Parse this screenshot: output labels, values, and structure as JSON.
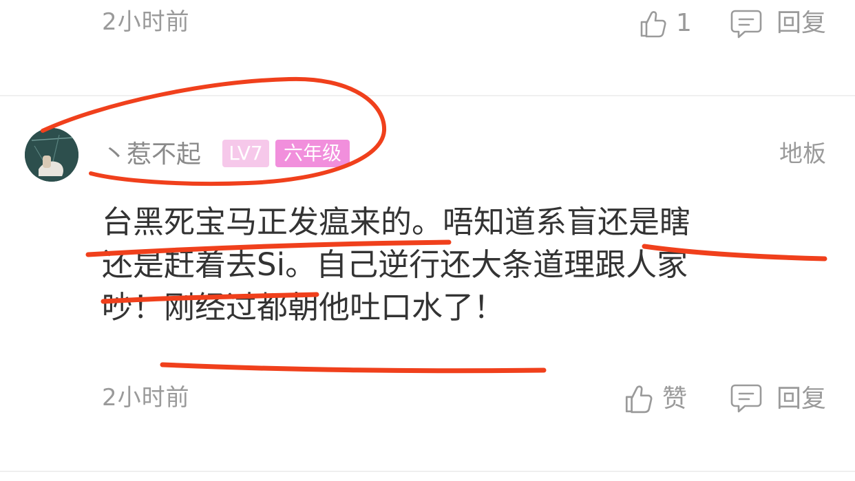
{
  "previous_comment": {
    "timestamp": "2小时前",
    "like_count": "1",
    "reply_label": "回复",
    "like_icon": "thumbs-up-icon",
    "reply_icon": "comment-bubble-icon"
  },
  "comment": {
    "username": "丶惹不起",
    "level_badge": "LV7",
    "grade_badge": "六年级",
    "floor_label": "地板",
    "content_lines": [
      "台黑死宝马正发瘟来的。唔知道系盲还是瞎",
      "还是赶着去Si。自己逆行还大条道理跟人家",
      "吵！刚经过都朝他吐口水了！"
    ],
    "timestamp": "2小时前",
    "like_label": "赞",
    "reply_label": "回复",
    "like_icon": "thumbs-up-icon",
    "reply_icon": "comment-bubble-icon"
  },
  "colors": {
    "annotation_red": "#f0401c",
    "level_badge_bg": "#f6c8ea",
    "grade_badge_bg": "#f18fdc",
    "meta_gray": "#9a9a9a",
    "divider": "#efefef"
  }
}
